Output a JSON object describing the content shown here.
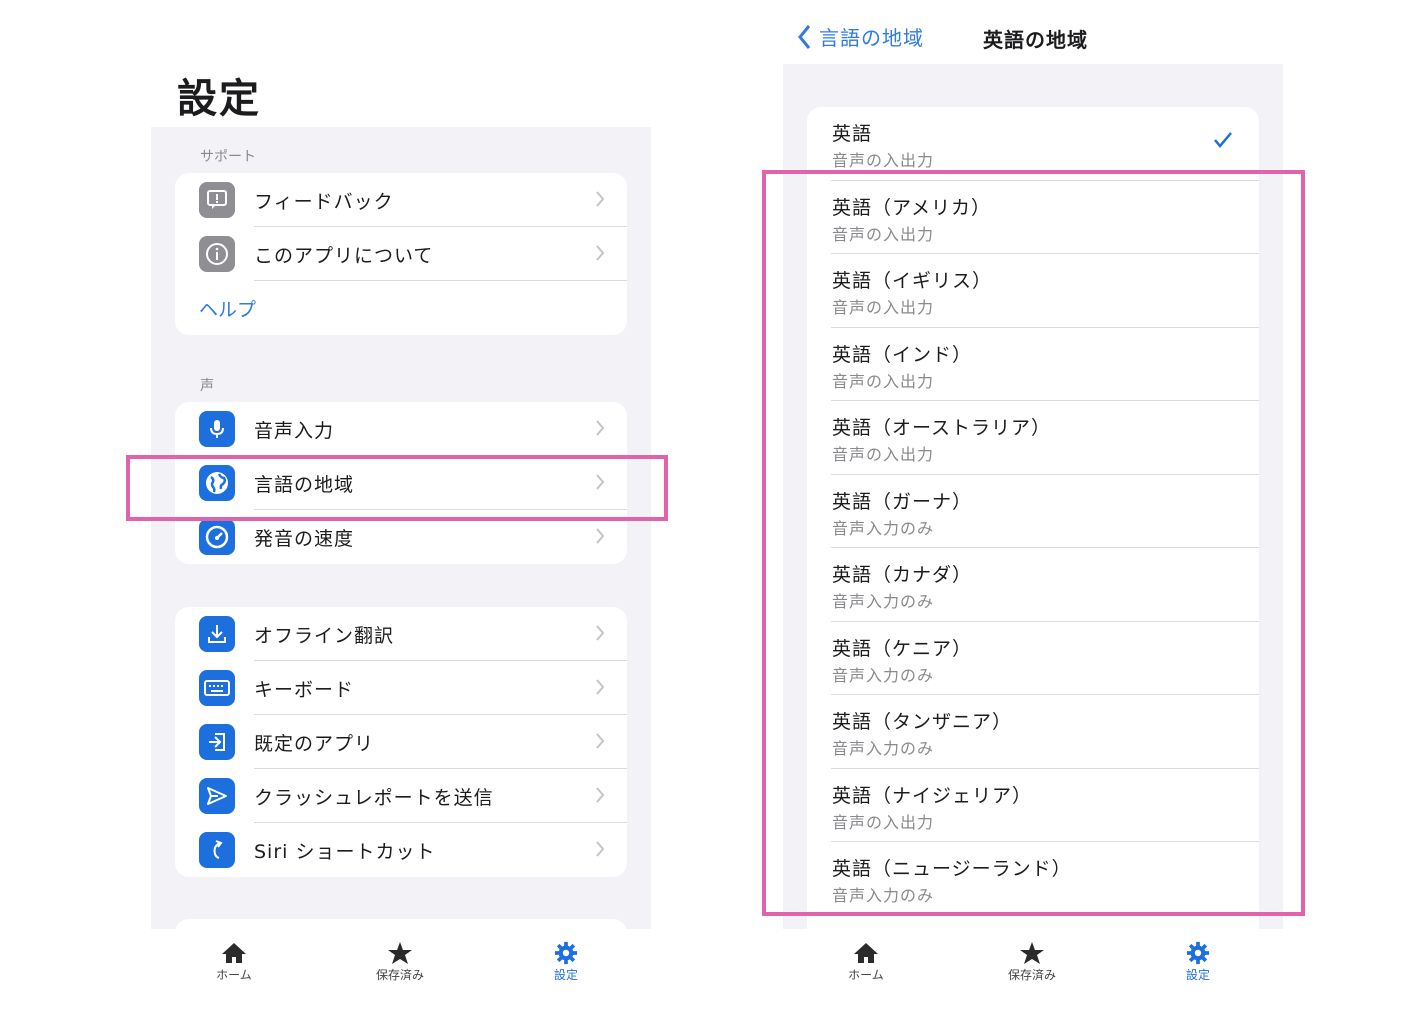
{
  "left": {
    "title": "設定",
    "support_header": "サポート",
    "support_items": [
      {
        "label": "フィードバック"
      },
      {
        "label": "このアプリについて"
      }
    ],
    "help_link": "ヘルプ",
    "voice_header": "声",
    "voice_items": [
      {
        "label": "音声入力"
      },
      {
        "label": "言語の地域"
      },
      {
        "label": "発音の速度"
      }
    ],
    "other_items": [
      {
        "label": "オフライン翻訳"
      },
      {
        "label": "キーボード"
      },
      {
        "label": "既定のアプリ"
      },
      {
        "label": "クラッシュレポートを送信"
      },
      {
        "label": "Siri ショートカット"
      }
    ]
  },
  "tabbar": {
    "home": "ホーム",
    "saved": "保存済み",
    "settings": "設定"
  },
  "right": {
    "back_label": "言語の地域",
    "title": "英語の地域",
    "languages": [
      {
        "name": "英語",
        "sub": "音声の入出力",
        "checked": true
      },
      {
        "name": "英語（アメリカ）",
        "sub": "音声の入出力"
      },
      {
        "name": "英語（イギリス）",
        "sub": "音声の入出力"
      },
      {
        "name": "英語（インド）",
        "sub": "音声の入出力"
      },
      {
        "name": "英語（オーストラリア）",
        "sub": "音声の入出力"
      },
      {
        "name": "英語（ガーナ）",
        "sub": "音声入力のみ"
      },
      {
        "name": "英語（カナダ）",
        "sub": "音声入力のみ"
      },
      {
        "name": "英語（ケニア）",
        "sub": "音声入力のみ"
      },
      {
        "name": "英語（タンザニア）",
        "sub": "音声入力のみ"
      },
      {
        "name": "英語（ナイジェリア）",
        "sub": "音声の入出力"
      },
      {
        "name": "英語（ニュージーランド）",
        "sub": "音声入力のみ"
      }
    ]
  },
  "colors": {
    "accent": "#1e6fde",
    "link": "#2f7be0",
    "highlight": "#e064ac",
    "grouped_bg": "#f2f2f7"
  }
}
